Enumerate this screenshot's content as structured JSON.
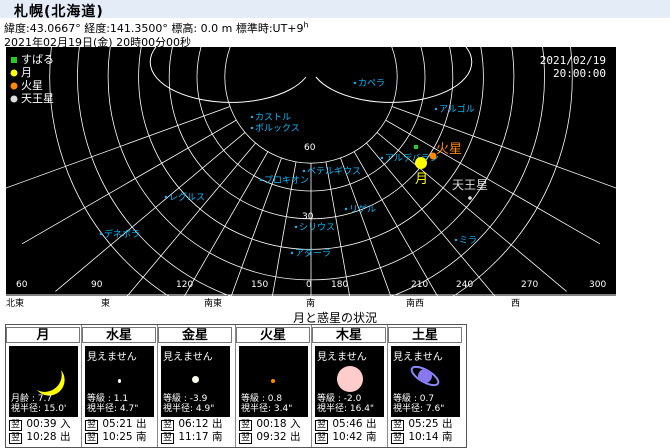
{
  "header": {
    "title": "札幌(北海道)",
    "latitude": "緯度:43.0667°",
    "longitude": "経度:141.3500°",
    "altitude": "標高: 0.0 m",
    "timezone": "標準時:UT+9",
    "timezone_sup": "h",
    "datetime": "2021年02月19日(金) 20時00分00秒"
  },
  "sky": {
    "date": "2021/02/19",
    "time": "20:00:00",
    "legend": [
      {
        "label": "すばる",
        "color": "#22cc22",
        "shape": "square"
      },
      {
        "label": "月",
        "color": "#ffff00",
        "shape": "circle"
      },
      {
        "label": "火星",
        "color": "#ff8800",
        "shape": "circle"
      },
      {
        "label": "天王星",
        "color": "#dddddd",
        "shape": "circle"
      }
    ],
    "altitude_labels": [
      "60",
      "30"
    ],
    "azimuth_degrees": [
      "60",
      "90",
      "120",
      "150",
      "0",
      "180",
      "210",
      "240",
      "270",
      "300"
    ],
    "direction_labels": [
      "北東",
      "東",
      "南東",
      "南",
      "南西",
      "西"
    ],
    "stars": [
      "カペラ",
      "アルゴル",
      "カストル",
      "ポルックス",
      "アルデバラン",
      "ベテルギウス",
      "プロキオン",
      "リゲル",
      "レグルス",
      "シリウス",
      "デネボラ",
      "ミラ",
      "アダーラ"
    ],
    "planet_labels": {
      "moon": "月",
      "mars": "火星",
      "uranus": "天王星"
    },
    "colors": {
      "star": "#00bbff",
      "grid": "#ffffff",
      "background": "#000000"
    }
  },
  "section_title": "月と惑星の状況",
  "planets": [
    {
      "name": "月",
      "visible": true,
      "message": "",
      "stat1": "月齢 : 7.7",
      "stat2": "視半径: 15.0'",
      "event1_time": "00:39",
      "event1_type": "入",
      "event2_time": "10:28",
      "event2_type": "出"
    },
    {
      "name": "水星",
      "visible": false,
      "message": "見えません",
      "stat1": "等級 : 1.1",
      "stat2": "視半径: 4.7\"",
      "event1_time": "05:21",
      "event1_type": "出",
      "event2_time": "10:25",
      "event2_type": "南"
    },
    {
      "name": "金星",
      "visible": false,
      "message": "見えません",
      "stat1": "等級 : -3.9",
      "stat2": "視半径: 4.9\"",
      "event1_time": "06:12",
      "event1_type": "出",
      "event2_time": "11:17",
      "event2_type": "南"
    },
    {
      "name": "火星",
      "visible": true,
      "message": "",
      "stat1": "等級 : 0.8",
      "stat2": "視半径: 3.4\"",
      "event1_time": "00:18",
      "event1_type": "入",
      "event2_time": "09:32",
      "event2_type": "出"
    },
    {
      "name": "木星",
      "visible": false,
      "message": "見えません",
      "stat1": "等級 : -2.0",
      "stat2": "視半径: 16.4\"",
      "event1_time": "05:46",
      "event1_type": "出",
      "event2_time": "10:42",
      "event2_type": "南"
    },
    {
      "name": "土星",
      "visible": false,
      "message": "見えません",
      "stat1": "等級 : 0.7",
      "stat2": "視半径: 7.6\"",
      "event1_time": "05:25",
      "event1_type": "出",
      "event2_time": "10:14",
      "event2_type": "南"
    }
  ],
  "next_day_mark": "翌"
}
